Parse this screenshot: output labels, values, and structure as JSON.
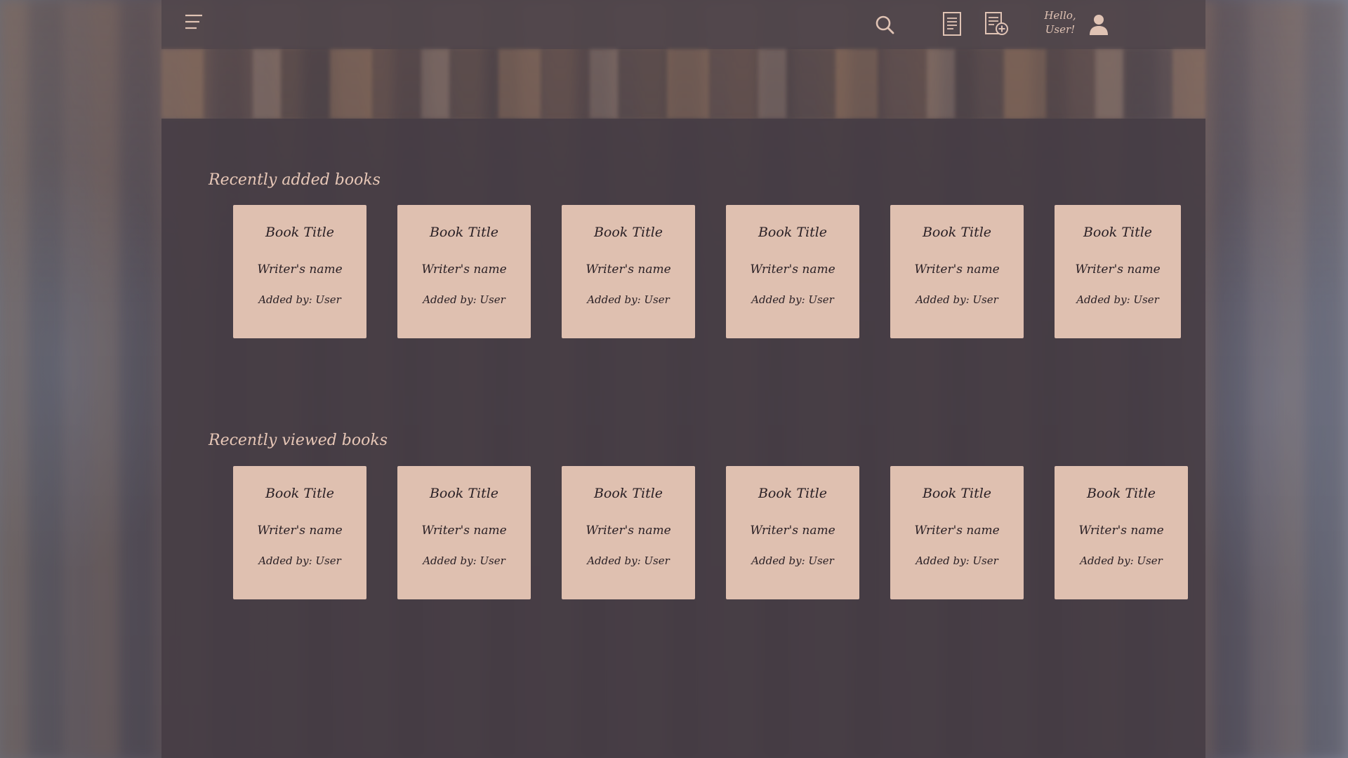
{
  "header": {
    "menu_icon": "hamburger-menu-icon",
    "search_icon": "search-icon",
    "books_icon": "document-icon",
    "add_book_icon": "document-add-icon",
    "greeting_line1": "Hello,",
    "greeting_line2": "User!",
    "user_icon": "user-icon"
  },
  "colors": {
    "accent": "#e7c7b7",
    "card_bg": "#dfc0b0",
    "panel_bg": "#463c44",
    "icon": "#e0c3b4"
  },
  "recently_added": {
    "title": "Recently added books",
    "books": [
      {
        "title": "Book Title",
        "writer": "Writer's name",
        "added_by": "Added by: User"
      },
      {
        "title": "Book Title",
        "writer": "Writer's name",
        "added_by": "Added by: User"
      },
      {
        "title": "Book Title",
        "writer": "Writer's name",
        "added_by": "Added by: User"
      },
      {
        "title": "Book Title",
        "writer": "Writer's name",
        "added_by": "Added by: User"
      },
      {
        "title": "Book Title",
        "writer": "Writer's name",
        "added_by": "Added by: User"
      },
      {
        "title": "Book Title",
        "writer": "Writer's name",
        "added_by": "Added by: User"
      }
    ]
  },
  "recently_viewed": {
    "title": "Recently viewed books",
    "books": [
      {
        "title": "Book Title",
        "writer": "Writer's name",
        "added_by": "Added by: User"
      },
      {
        "title": "Book Title",
        "writer": "Writer's name",
        "added_by": "Added by: User"
      },
      {
        "title": "Book Title",
        "writer": "Writer's name",
        "added_by": "Added by: User"
      },
      {
        "title": "Book Title",
        "writer": "Writer's name",
        "added_by": "Added by: User"
      },
      {
        "title": "Book Title",
        "writer": "Writer's name",
        "added_by": "Added by: User"
      },
      {
        "title": "Book Title",
        "writer": "Writer's name",
        "added_by": "Added by: User"
      }
    ]
  }
}
